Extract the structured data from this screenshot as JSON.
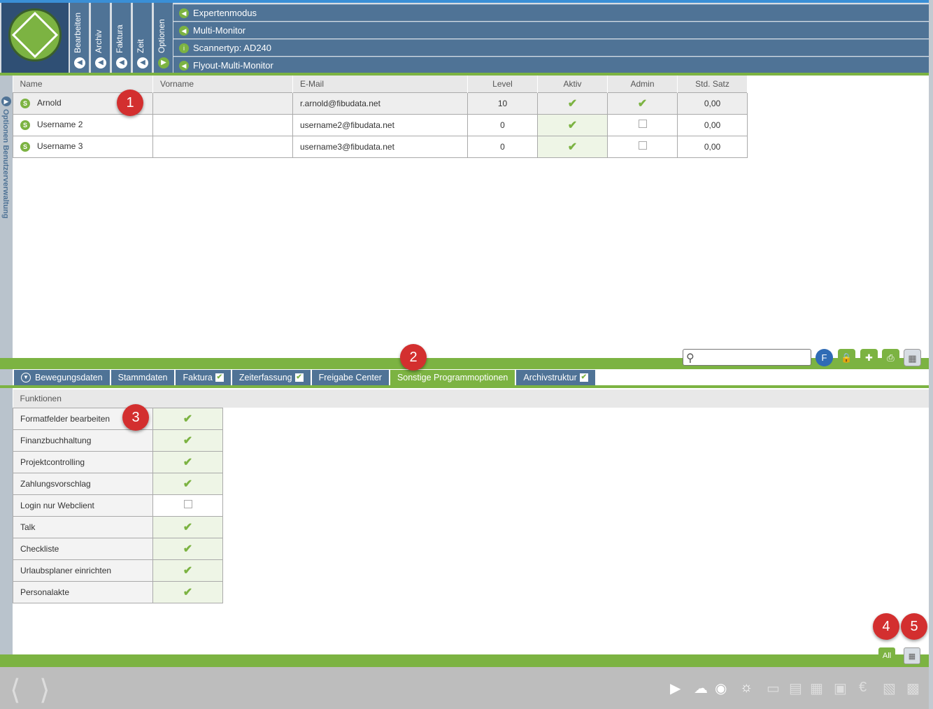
{
  "nav": {
    "vertical_tabs": [
      {
        "label": "Bearbeiten"
      },
      {
        "label": "Archiv"
      },
      {
        "label": "Faktura"
      },
      {
        "label": "Zeit"
      },
      {
        "label": "Optionen"
      }
    ],
    "menu_items": [
      {
        "label": "Expertenmodus"
      },
      {
        "label": "Multi-Monitor"
      },
      {
        "label": "Scannertyp: AD240"
      },
      {
        "label": "Flyout-Multi-Monitor"
      }
    ]
  },
  "sidebar": {
    "label": "Optionen  Benutzerverwaltung"
  },
  "users_table": {
    "headers": [
      "Name",
      "Vorname",
      "E-Mail",
      "Level",
      "Aktiv",
      "Admin",
      "Std. Satz"
    ],
    "rows": [
      {
        "name": "Arnold",
        "vorname": "",
        "email": "r.arnold@fibudata.net",
        "level": "10",
        "aktiv": true,
        "admin": true,
        "std_satz": "0,00"
      },
      {
        "name": "Username 2",
        "vorname": "",
        "email": "username2@fibudata.net",
        "level": "0",
        "aktiv": true,
        "admin": false,
        "std_satz": "0,00"
      },
      {
        "name": "Username 3",
        "vorname": "",
        "email": "username3@fibudata.net",
        "level": "0",
        "aktiv": true,
        "admin": false,
        "std_satz": "0,00"
      }
    ]
  },
  "search": {
    "placeholder": ""
  },
  "toolbar": {
    "f_label": "F"
  },
  "tabs": [
    {
      "label": "Bewegungsdaten",
      "checked": false
    },
    {
      "label": "Stammdaten",
      "checked": false
    },
    {
      "label": "Faktura",
      "checked": true
    },
    {
      "label": "Zeiterfassung",
      "checked": true
    },
    {
      "label": "Freigabe Center",
      "checked": false
    },
    {
      "label": "Sonstige Programmoptionen",
      "checked": false,
      "active": true
    },
    {
      "label": "Archivstruktur",
      "checked": true
    }
  ],
  "functions_table": {
    "header": "Funktionen",
    "rows": [
      {
        "label": "Formatfelder bearbeiten",
        "checked": true
      },
      {
        "label": "Finanzbuchhaltung",
        "checked": true
      },
      {
        "label": "Projektcontrolling",
        "checked": true
      },
      {
        "label": "Zahlungsvorschlag",
        "checked": true
      },
      {
        "label": "Login nur Webclient",
        "checked": false
      },
      {
        "label": "Talk",
        "checked": true
      },
      {
        "label": "Checkliste",
        "checked": true
      },
      {
        "label": "Urlaubsplaner einrichten",
        "checked": true
      },
      {
        "label": "Personalakte",
        "checked": true
      }
    ]
  },
  "bottom_buttons": {
    "all_label": "All"
  },
  "badges": [
    "1",
    "2",
    "3",
    "4",
    "5"
  ],
  "colors": {
    "accent_green": "#7cb342",
    "nav_blue": "#4f7396",
    "badge_red": "#d32f2f"
  }
}
